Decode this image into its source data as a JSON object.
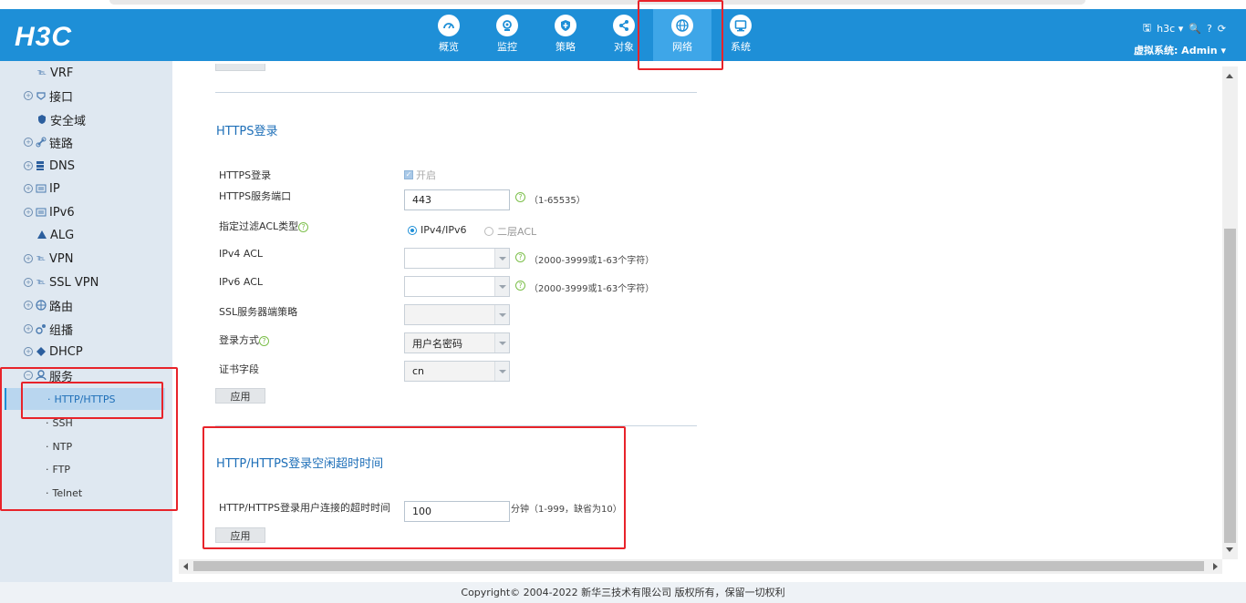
{
  "logo": "H3C",
  "nav": [
    {
      "label": "概览",
      "icon": "dashboard-icon"
    },
    {
      "label": "监控",
      "icon": "monitor-eye-icon"
    },
    {
      "label": "策略",
      "icon": "shield-icon"
    },
    {
      "label": "对象",
      "icon": "share-nodes-icon"
    },
    {
      "label": "网络",
      "icon": "globe-icon",
      "active": true
    },
    {
      "label": "系统",
      "icon": "display-icon"
    }
  ],
  "header_right": {
    "user": "h3c",
    "vsys_label": "虚拟系统: Admin"
  },
  "sidebar": {
    "items": [
      {
        "label": "VRF",
        "icon": "vrf-icon",
        "expandable": false
      },
      {
        "label": "接口",
        "icon": "interface-icon",
        "expandable": true
      },
      {
        "label": "安全域",
        "icon": "security-zone-icon",
        "expandable": false
      },
      {
        "label": "链路",
        "icon": "link-icon",
        "expandable": true
      },
      {
        "label": "DNS",
        "icon": "dns-icon",
        "expandable": true
      },
      {
        "label": "IP",
        "icon": "ip-icon",
        "expandable": true
      },
      {
        "label": "IPv6",
        "icon": "ipv6-icon",
        "expandable": true
      },
      {
        "label": "ALG",
        "icon": "alg-icon",
        "expandable": false
      },
      {
        "label": "VPN",
        "icon": "vpn-icon",
        "expandable": true
      },
      {
        "label": "SSL VPN",
        "icon": "sslvpn-icon",
        "expandable": true
      },
      {
        "label": "路由",
        "icon": "route-icon",
        "expandable": true
      },
      {
        "label": "组播",
        "icon": "multicast-icon",
        "expandable": true
      },
      {
        "label": "DHCP",
        "icon": "dhcp-icon",
        "expandable": true
      },
      {
        "label": "服务",
        "icon": "service-icon",
        "expandable": true
      }
    ],
    "service_subitems": [
      "HTTP/HTTPS",
      "SSH",
      "NTP",
      "FTP",
      "Telnet"
    ],
    "selected": "HTTP/HTTPS"
  },
  "https_section": {
    "title": "HTTPS登录",
    "login_label": "HTTPS登录",
    "login_checkbox": "开启",
    "port_label": "HTTPS服务端口",
    "port_value": "443",
    "port_hint": "（1-65535）",
    "acl_type_label": "指定过滤ACL类型",
    "acl_type_options": [
      "IPv4/IPv6",
      "二层ACL"
    ],
    "ipv4_acl_label": "IPv4 ACL",
    "ipv4_acl_hint": "（2000-3999或1-63个字符）",
    "ipv6_acl_label": "IPv6 ACL",
    "ipv6_acl_hint": "（2000-3999或1-63个字符）",
    "ssl_policy_label": "SSL服务器端策略",
    "login_method_label": "登录方式",
    "login_method_value": "用户名密码",
    "cert_field_label": "证书字段",
    "cert_field_value": "cn",
    "apply": "应用"
  },
  "timeout_section": {
    "title": "HTTP/HTTPS登录空闲超时时间",
    "timeout_label": "HTTP/HTTPS登录用户连接的超时时间",
    "timeout_value": "100",
    "timeout_hint": "分钟（1-999，缺省为10）",
    "apply": "应用"
  },
  "footer": "Copyright© 2004-2022 新华三技术有限公司 版权所有，保留一切权利",
  "colors": {
    "header": "#1e8fd7",
    "accent": "#1e6fb8",
    "highlight_box": "#e8232a"
  }
}
